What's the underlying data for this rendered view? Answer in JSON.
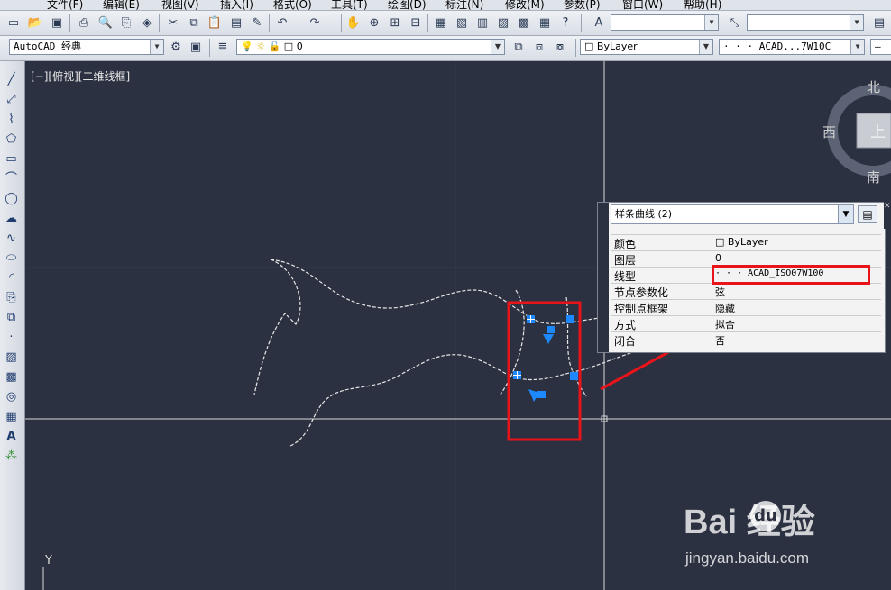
{
  "menu": {
    "items": [
      "文件(F)",
      "编辑(E)",
      "视图(V)",
      "插入(I)",
      "格式(O)",
      "工具(T)",
      "绘图(D)",
      "标注(N)",
      "修改(M)",
      "参数(P)",
      "窗口(W)",
      "帮助(H)"
    ]
  },
  "toolbar2": {
    "workspace": "AutoCAD 经典",
    "layer_value": "0",
    "color_value": "ByLayer",
    "linetype_value": "· · ·  ACAD...7W10C"
  },
  "viewport": {
    "label": "[−][俯视][二维线框]",
    "ucs_y": "Y"
  },
  "viewcube": {
    "north": "北",
    "south": "南",
    "west": "西",
    "top_face": "上"
  },
  "properties": {
    "object_type": "样条曲线 (2)",
    "rows": [
      {
        "key": "颜色",
        "value": "□ ByLayer"
      },
      {
        "key": "图层",
        "value": "0"
      },
      {
        "key": "线型",
        "value": "· · ·  ACAD_ISO07W100"
      },
      {
        "key": "节点参数化",
        "value": "弦"
      },
      {
        "key": "控制点框架",
        "value": "隐藏"
      },
      {
        "key": "方式",
        "value": "拟合"
      },
      {
        "key": "闭合",
        "value": "否"
      }
    ]
  },
  "watermark": {
    "brand": "Bai  经验",
    "du": "du",
    "url": "jingyan.baidu.com"
  },
  "colors": {
    "canvas": "#2b3140",
    "highlight_red": "#e8141a",
    "grip_blue": "#1e88ff"
  }
}
